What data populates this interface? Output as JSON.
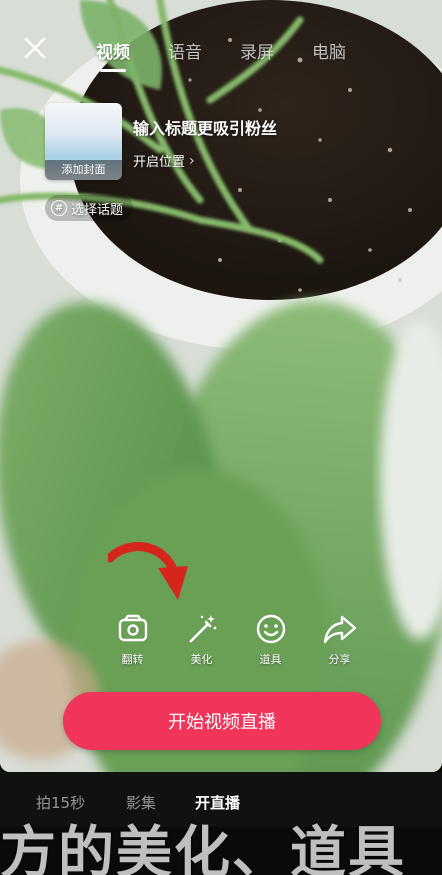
{
  "header": {
    "tabs": [
      {
        "label": "视频",
        "active": true
      },
      {
        "label": "语音",
        "active": false
      },
      {
        "label": "录屏",
        "active": false
      },
      {
        "label": "电脑",
        "active": false
      }
    ]
  },
  "cover": {
    "label": "添加封面"
  },
  "title_input": {
    "placeholder": "输入标题更吸引粉丝"
  },
  "location": {
    "label": "开启位置"
  },
  "topic": {
    "label": "选择话题",
    "icon": "hash-icon"
  },
  "tools": [
    {
      "label": "翻转",
      "icon": "camera-flip-icon"
    },
    {
      "label": "美化",
      "icon": "magic-wand-icon"
    },
    {
      "label": "道具",
      "icon": "smiley-icon"
    },
    {
      "label": "分享",
      "icon": "share-arrow-icon"
    }
  ],
  "start_button": {
    "label": "开始视频直播"
  },
  "modes": [
    {
      "label": "拍15秒",
      "active": false
    },
    {
      "label": "影集",
      "active": false
    },
    {
      "label": "开直播",
      "active": true
    }
  ],
  "subtitle": "方的美化、道具",
  "colors": {
    "accent": "#f1345a",
    "annotation_arrow": "#d6261c"
  }
}
